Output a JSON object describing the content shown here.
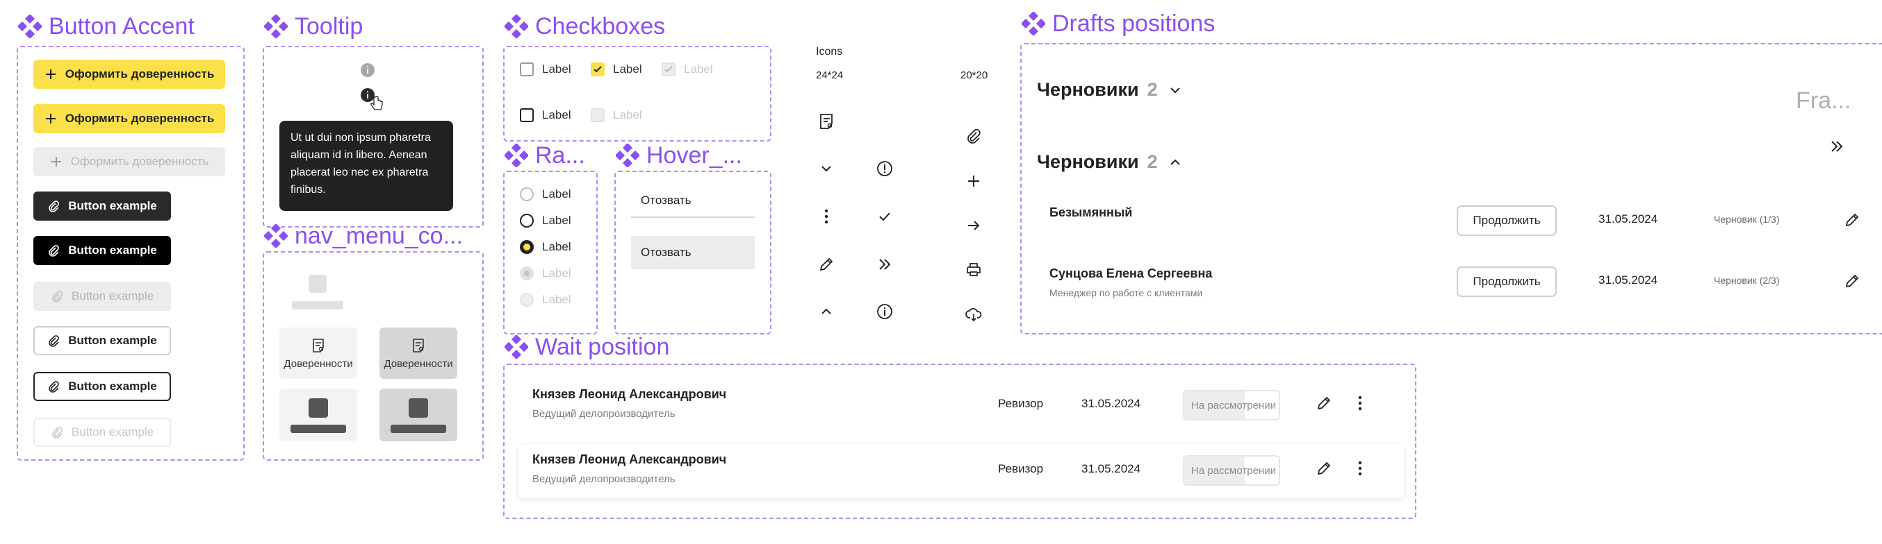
{
  "sections": {
    "button_accent": "Button Accent",
    "tooltip": "Tooltip",
    "checkboxes": "Checkboxes",
    "radio": "Ra...",
    "hover": "Hover_...",
    "nav_menu": "nav_menu_co...",
    "wait_position": "Wait position",
    "drafts_positions": "Drafts positions"
  },
  "buttons": {
    "accent_label": "Оформить доверенность",
    "example_label": "Button example"
  },
  "tooltip": {
    "text": "Ut ut dui non ipsum pharetra aliquam id in libero. Aenean placerat leo nec ex pharetra finibus."
  },
  "checkboxes": {
    "label": "Label"
  },
  "radio": {
    "label": "Label"
  },
  "hover": {
    "item": "Отозвать"
  },
  "nav_menu": {
    "item": "Доверенности"
  },
  "icons": {
    "title": "Icons",
    "size_a": "24*24",
    "size_b": "20*20"
  },
  "wait": {
    "rows": [
      {
        "name": "Князев Леонид Александрович",
        "role": "Ведущий делопроизводитель",
        "position": "Ревизор",
        "date": "31.05.2024",
        "status": "На рассмотрении"
      },
      {
        "name": "Князев Леонид Александрович",
        "role": "Ведущий делопроизводитель",
        "position": "Ревизор",
        "date": "31.05.2024",
        "status": "На рассмотрении"
      }
    ]
  },
  "drafts": {
    "title": "Черновики",
    "count": "2",
    "frame_label": "Fra...",
    "rows": [
      {
        "name": "Безымянный",
        "role": "",
        "button": "Продолжить",
        "date": "31.05.2024",
        "status": "Черновик (1/3)"
      },
      {
        "name": "Сунцова Елена Сергеевна",
        "role": "Менеджер по работе с клиентами",
        "button": "Продолжить",
        "date": "31.05.2024",
        "status": "Черновик (2/3)"
      }
    ]
  },
  "colors": {
    "accent": "#8a4ff0",
    "yellow": "#fbe04a",
    "dark": "#2a2a2a"
  }
}
